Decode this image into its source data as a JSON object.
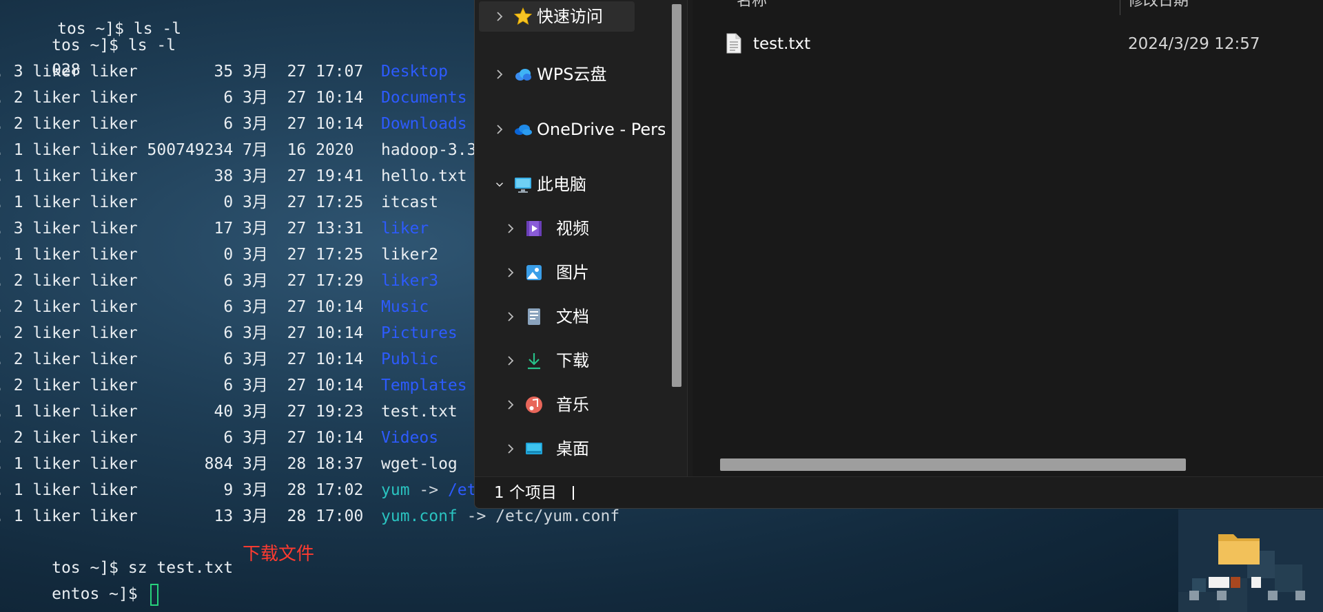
{
  "terminal": {
    "top_prompt": "tos ~]$ ls -l",
    "total": "028",
    "listing": [
      {
        "meta": ". 3 liker liker        35 3月  27 17:07",
        "name": "Desktop",
        "kind": "dir"
      },
      {
        "meta": ". 2 liker liker         6 3月  27 10:14",
        "name": "Documents",
        "kind": "dir"
      },
      {
        "meta": ". 2 liker liker         6 3月  27 10:14",
        "name": "Downloads",
        "kind": "dir"
      },
      {
        "meta": ". 1 liker liker 500749234 7月  16 2020",
        "name": "hadoop-3.3.",
        "kind": "file"
      },
      {
        "meta": ". 1 liker liker        38 3月  27 19:41",
        "name": "hello.txt",
        "kind": "file"
      },
      {
        "meta": ". 1 liker liker         0 3月  27 17:25",
        "name": "itcast",
        "kind": "file"
      },
      {
        "meta": ". 3 liker liker        17 3月  27 13:31",
        "name": "liker",
        "kind": "dir"
      },
      {
        "meta": ". 1 liker liker         0 3月  27 17:25",
        "name": "liker2",
        "kind": "file"
      },
      {
        "meta": ". 2 liker liker         6 3月  27 17:29",
        "name": "liker3",
        "kind": "dir"
      },
      {
        "meta": ". 2 liker liker         6 3月  27 10:14",
        "name": "Music",
        "kind": "dir"
      },
      {
        "meta": ". 2 liker liker         6 3月  27 10:14",
        "name": "Pictures",
        "kind": "dir"
      },
      {
        "meta": ". 2 liker liker         6 3月  27 10:14",
        "name": "Public",
        "kind": "dir"
      },
      {
        "meta": ". 2 liker liker         6 3月  27 10:14",
        "name": "Templates",
        "kind": "dir"
      },
      {
        "meta": ". 1 liker liker        40 3月  27 19:23",
        "name": "test.txt",
        "kind": "file"
      },
      {
        "meta": ". 2 liker liker         6 3月  27 10:14",
        "name": "Videos",
        "kind": "dir"
      },
      {
        "meta": ". 1 liker liker       884 3月  28 18:37",
        "name": "wget-log",
        "kind": "file"
      },
      {
        "meta": ". 1 liker liker         9 3月  28 17:02",
        "name": "yum",
        "kind": "link",
        "arrow": " -> ",
        "target": "/et"
      },
      {
        "meta": ". 1 liker liker        13 3月  28 17:00",
        "name": "yum.conf",
        "kind": "link",
        "arrow": " -> ",
        "target": "/etc/yum.conf"
      }
    ],
    "sz_prompt": "tos ~]$ sz test.txt",
    "last_prompt": "entos ~]$ ",
    "annotation": "下载文件",
    "colors": {
      "dir": "#2d5bff",
      "link": "#2ac3c0",
      "file": "#e9eef2",
      "annotation": "#ff3b30",
      "cursor": "#27d17c"
    }
  },
  "explorer": {
    "nav": [
      {
        "label": "快速访问",
        "icon": "star-icon",
        "selected": true
      },
      {
        "label": "WPS云盘",
        "icon": "wps-cloud-icon"
      },
      {
        "label": "OneDrive - Pers",
        "icon": "onedrive-cloud-icon"
      },
      {
        "label": "此电脑",
        "icon": "this-pc-icon",
        "expanded": true
      },
      {
        "label": "视频",
        "icon": "videos-icon"
      },
      {
        "label": "图片",
        "icon": "pictures-icon"
      },
      {
        "label": "文档",
        "icon": "documents-icon"
      },
      {
        "label": "下载",
        "icon": "downloads-icon"
      },
      {
        "label": "音乐",
        "icon": "music-icon"
      },
      {
        "label": "桌面",
        "icon": "desktop-icon"
      }
    ],
    "columns": {
      "name": "名称",
      "modified": "修改日期"
    },
    "files": [
      {
        "name": "test.txt",
        "modified": "2024/3/29 12:57",
        "icon": "text-file-icon"
      }
    ],
    "status": "1 个项目"
  }
}
